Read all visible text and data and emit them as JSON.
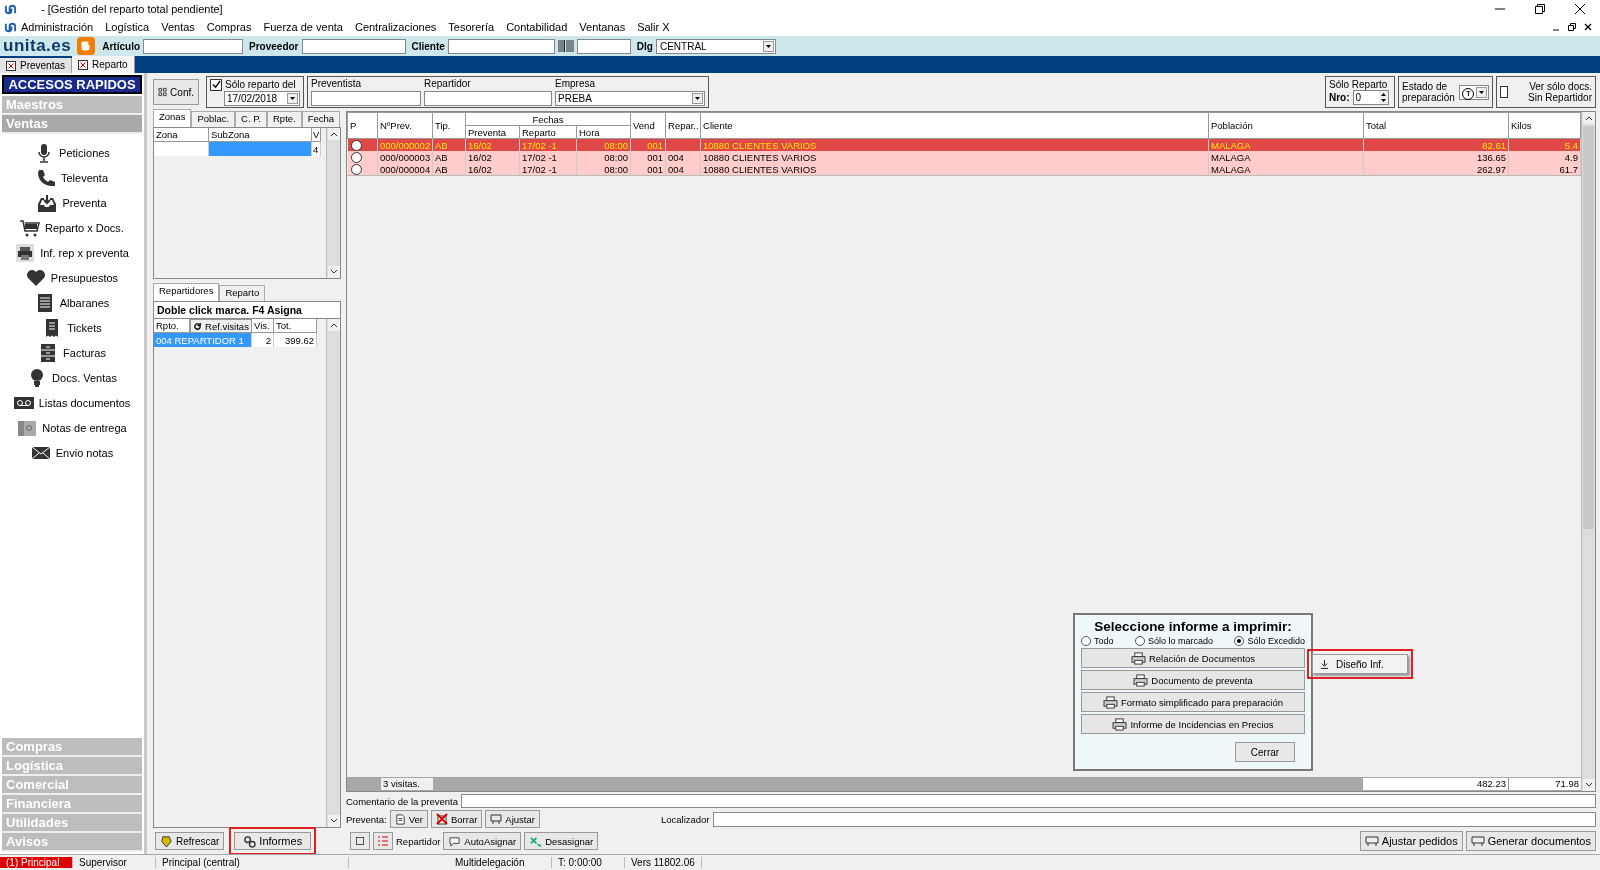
{
  "window": {
    "title": "- [Gestión del reparto total pendiente]"
  },
  "menu": [
    "Administración",
    "Logística",
    "Ventas",
    "Compras",
    "Fuerza de venta",
    "Centralizaciones",
    "Tesorería",
    "Contabilidad",
    "Ventanas",
    "Salir X"
  ],
  "toolbar": {
    "logo": "unita.es",
    "fields": [
      {
        "label": "Artículo"
      },
      {
        "label": "Proveedor"
      },
      {
        "label": "Cliente"
      }
    ],
    "dlg": {
      "label": "Dlg",
      "value": "CENTRAL"
    }
  },
  "doc_tabs": [
    {
      "label": "Preventas",
      "selected": false
    },
    {
      "label": "Reparto",
      "selected": true
    }
  ],
  "sidebar": {
    "title": "ACCESOS RAPIDOS",
    "sections": [
      {
        "label": "Maestros",
        "expanded": false
      },
      {
        "label": "Ventas",
        "expanded": true,
        "items": [
          {
            "label": "Peticiones",
            "kind": "mic"
          },
          {
            "label": "Televenta",
            "kind": "phone"
          },
          {
            "label": "Preventa",
            "kind": "inbox"
          },
          {
            "label": "Reparto x Docs.",
            "kind": "cart"
          },
          {
            "label": "Inf. rep x preventa",
            "kind": "printer"
          },
          {
            "label": "Presupuestos",
            "kind": "heart"
          },
          {
            "label": "Albaranes",
            "kind": "list"
          },
          {
            "label": "Tickets",
            "kind": "receipt"
          },
          {
            "label": "Facturas",
            "kind": "cabinet"
          },
          {
            "label": "Docs. Ventas",
            "kind": "bulb"
          },
          {
            "label": "Listas documentos",
            "kind": "tape"
          },
          {
            "label": "Notas de entrega",
            "kind": "box"
          },
          {
            "label": "Envio notas",
            "kind": "mail"
          }
        ]
      },
      {
        "label": "Compras",
        "expanded": false
      },
      {
        "label": "Logística",
        "expanded": false
      },
      {
        "label": "Comercial",
        "expanded": false
      },
      {
        "label": "Financiera",
        "expanded": false
      },
      {
        "label": "Utilidades",
        "expanded": false
      },
      {
        "label": "Avisos",
        "expanded": false
      }
    ]
  },
  "filters": {
    "conf": "Conf.",
    "date": {
      "label": "Sólo reparto del",
      "checked": true,
      "value": "17/02/2018"
    },
    "preventista": "Preventista",
    "repartidor": "Repartidor",
    "empresa": {
      "label": "Empresa",
      "value": "PREBA"
    },
    "solo_reparto": {
      "label": "Sólo Reparto",
      "nro": "Nro:",
      "value": "0"
    },
    "estado": {
      "label": "Estado de preparación",
      "value": "T"
    },
    "sin_repartidor": {
      "label": "Ver sólo docs. Sin Repartidor",
      "checked": false
    }
  },
  "zone_tabs": [
    {
      "label": "Zonas",
      "selected": true
    },
    {
      "label": "Poblac.",
      "selected": false
    },
    {
      "label": "C. P.",
      "selected": false
    },
    {
      "label": "Rpte.",
      "selected": false
    },
    {
      "label": "Fecha",
      "selected": false
    }
  ],
  "zone_grid": {
    "columns": [
      "Zona",
      "SubZona",
      "V"
    ],
    "row_value": "4"
  },
  "rep_tabs": [
    {
      "label": "Repartidores",
      "selected": true
    },
    {
      "label": "Reparto",
      "selected": false
    }
  ],
  "rep_hint": "Doble click marca. F4 Asigna",
  "rep_grid": {
    "columns": [
      "Rpto.",
      "Ref.visitas",
      "Vis.",
      "Tot."
    ],
    "rows": [
      {
        "name": "004 REPARTIDOR 1",
        "vis": "2",
        "tot": "399.62",
        "selected": true
      }
    ]
  },
  "table": {
    "group": "Fechas",
    "columns": [
      "P",
      "NºPrev.",
      "Tip.",
      "Preventa",
      "Reparto",
      "Hora",
      "Vend",
      "Repar..",
      "Cliente",
      "Población",
      "Total",
      "Kilos"
    ],
    "rows": [
      {
        "cells": [
          "",
          "000/000002",
          "AB",
          "16/02",
          "17/02 -1",
          "08:00",
          "001",
          "",
          "10880 CLIENTES VARIOS",
          "MALAGA",
          "82.61",
          "5.4"
        ],
        "checked": false,
        "selected": true
      },
      {
        "cells": [
          "",
          "000/000003",
          "AB",
          "16/02",
          "17/02 -1",
          "08:00",
          "001",
          "004",
          "10880 CLIENTES VARIOS",
          "MALAGA",
          "136.65",
          "4.9"
        ],
        "checked": false,
        "selected": false
      },
      {
        "cells": [
          "",
          "000/000004",
          "AB",
          "16/02",
          "17/02 -1",
          "08:00",
          "001",
          "004",
          "10880 CLIENTES VARIOS",
          "MALAGA",
          "262.97",
          "61.7"
        ],
        "checked": false,
        "selected": false
      }
    ],
    "footer": {
      "count": "3 visitas.",
      "total": "482.23",
      "kilos": "71.98"
    }
  },
  "comment_label": "Comentario de la preventa",
  "preventa": {
    "label": "Preventa:",
    "buttons": [
      "Ver",
      "Borrar",
      "Ajustar"
    ],
    "localizador": "Localizador"
  },
  "bottom": {
    "left": [
      {
        "label": "Refrescar",
        "highlighted": false
      },
      {
        "label": "Informes",
        "highlighted": true
      }
    ],
    "repartidor": "Repartidor",
    "assign": [
      "AutoAsignar",
      "Desasignar"
    ],
    "right": [
      "Ajustar pedidos",
      "Generar documentos"
    ]
  },
  "dialog": {
    "title": "Seleccione informe a imprimir:",
    "options": [
      {
        "label": "Todo",
        "selected": false
      },
      {
        "label": "Sólo lo marcado",
        "selected": false
      },
      {
        "label": "Sólo Excedido",
        "selected": true
      }
    ],
    "reports": [
      "Relación de Documentos",
      "Documento de preventa",
      "Formato simplificado para preparación",
      "Informe de Incidencias en Precios"
    ],
    "close": "Cerrar",
    "popup": {
      "label": "Diseño Inf.",
      "highlighted": true
    }
  },
  "status_bar": [
    "(1) Principal",
    "Supervisor",
    "Principal (central)",
    "Multidelegación",
    "T: 0:00:00",
    "Vers 11802.06"
  ]
}
